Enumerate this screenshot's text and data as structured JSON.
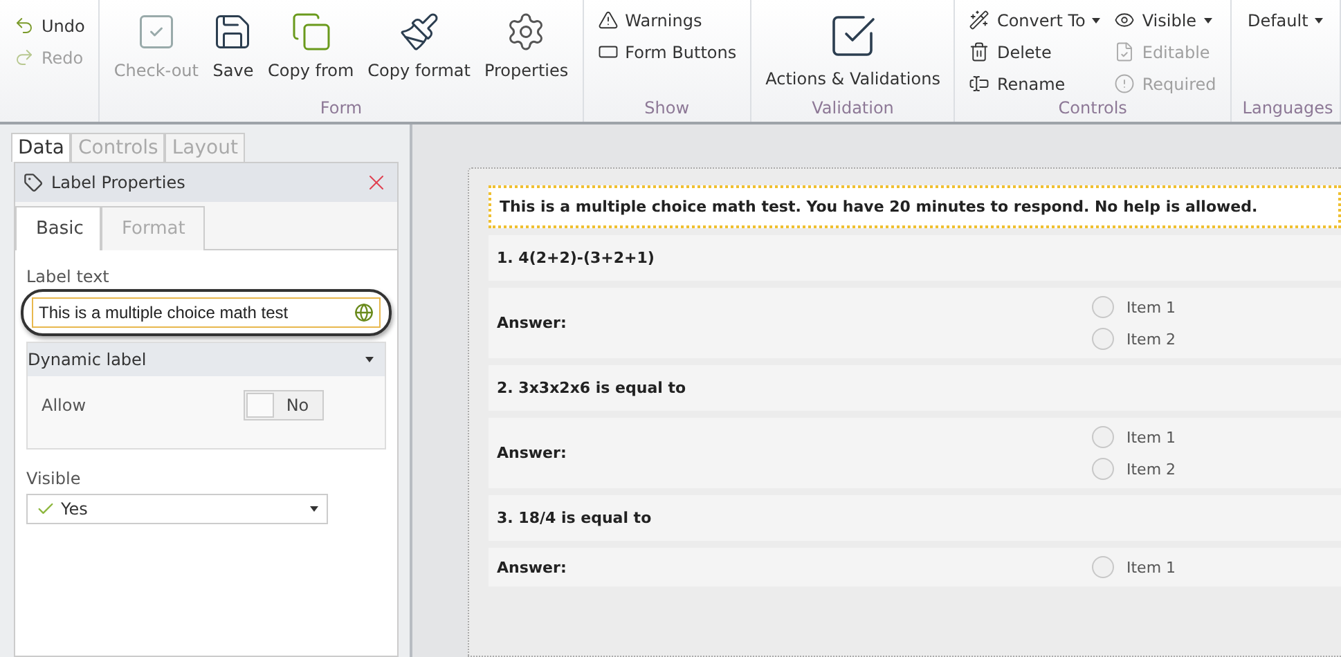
{
  "ribbon": {
    "history": [
      {
        "label": "Undo",
        "disabled": false,
        "kind": "undo"
      },
      {
        "label": "Redo",
        "disabled": true,
        "kind": "redo"
      }
    ],
    "groups": [
      {
        "title": "Form",
        "buttons": [
          {
            "label": "Check-out",
            "kind": "checkout",
            "disabled": true
          },
          {
            "label": "Save",
            "kind": "save",
            "disabled": false
          },
          {
            "label": "Copy from",
            "kind": "copy",
            "disabled": false
          },
          {
            "label": "Copy format",
            "kind": "brush",
            "disabled": false
          },
          {
            "label": "Properties",
            "kind": "gear",
            "disabled": false
          }
        ]
      },
      {
        "title": "Show",
        "columns": [
          [
            {
              "label": "Warnings",
              "kind": "warning",
              "disabled": false,
              "dropdown": false
            },
            {
              "label": "Form Buttons",
              "kind": "formbuttons",
              "disabled": false,
              "dropdown": false
            }
          ]
        ]
      },
      {
        "title": "Validation",
        "buttons": [
          {
            "label": "Actions & Validations",
            "kind": "validate",
            "disabled": false
          }
        ]
      },
      {
        "title": "Controls",
        "columns": [
          [
            {
              "label": "Convert To",
              "kind": "wand",
              "disabled": false,
              "dropdown": true
            },
            {
              "label": "Delete",
              "kind": "trash",
              "disabled": false,
              "dropdown": false
            },
            {
              "label": "Rename",
              "kind": "rename",
              "disabled": false,
              "dropdown": false
            }
          ],
          [
            {
              "label": "Visible",
              "kind": "eye",
              "disabled": false,
              "dropdown": true
            },
            {
              "label": "Editable",
              "kind": "file",
              "disabled": true,
              "dropdown": false
            },
            {
              "label": "Required",
              "kind": "alert",
              "disabled": true,
              "dropdown": false
            }
          ]
        ]
      },
      {
        "title": "Languages",
        "columns": [
          [
            {
              "label": "Default",
              "kind": "none",
              "disabled": false,
              "dropdown": true
            }
          ]
        ]
      }
    ]
  },
  "sidebar": {
    "tabs": [
      {
        "label": "Data",
        "selected": true
      },
      {
        "label": "Controls",
        "selected": false
      },
      {
        "label": "Layout",
        "selected": false
      }
    ],
    "panel": {
      "title": "Label Properties",
      "tabs": [
        {
          "label": "Basic",
          "selected": true
        },
        {
          "label": "Format",
          "selected": false
        }
      ],
      "label_text": {
        "label": "Label text",
        "value": "This is a multiple choice math test"
      },
      "dynamic_label": {
        "title": "Dynamic label",
        "allow_label": "Allow",
        "allow": {
          "on": false,
          "text": "No"
        }
      },
      "visible": {
        "label": "Visible",
        "value": "Yes"
      }
    }
  },
  "form": {
    "intro": "This is a multiple choice math test. You have 20 minutes to respond. No help is allowed.",
    "questions": [
      {
        "title": "1. 4(2+2)-(3+2+1)",
        "answer_label": "Answer:",
        "options": [
          {
            "label": "Item 1",
            "selected": false
          },
          {
            "label": "Item 2",
            "selected": false
          }
        ]
      },
      {
        "title": "2. 3x3x2x6 is equal to",
        "answer_label": "Answer:",
        "options": [
          {
            "label": "Item 1",
            "selected": false
          },
          {
            "label": "Item 2",
            "selected": false
          }
        ]
      },
      {
        "title": "3. 18/4 is equal to",
        "answer_label": "Answer:",
        "options": [
          {
            "label": "Item 1",
            "selected": false
          }
        ]
      }
    ]
  }
}
